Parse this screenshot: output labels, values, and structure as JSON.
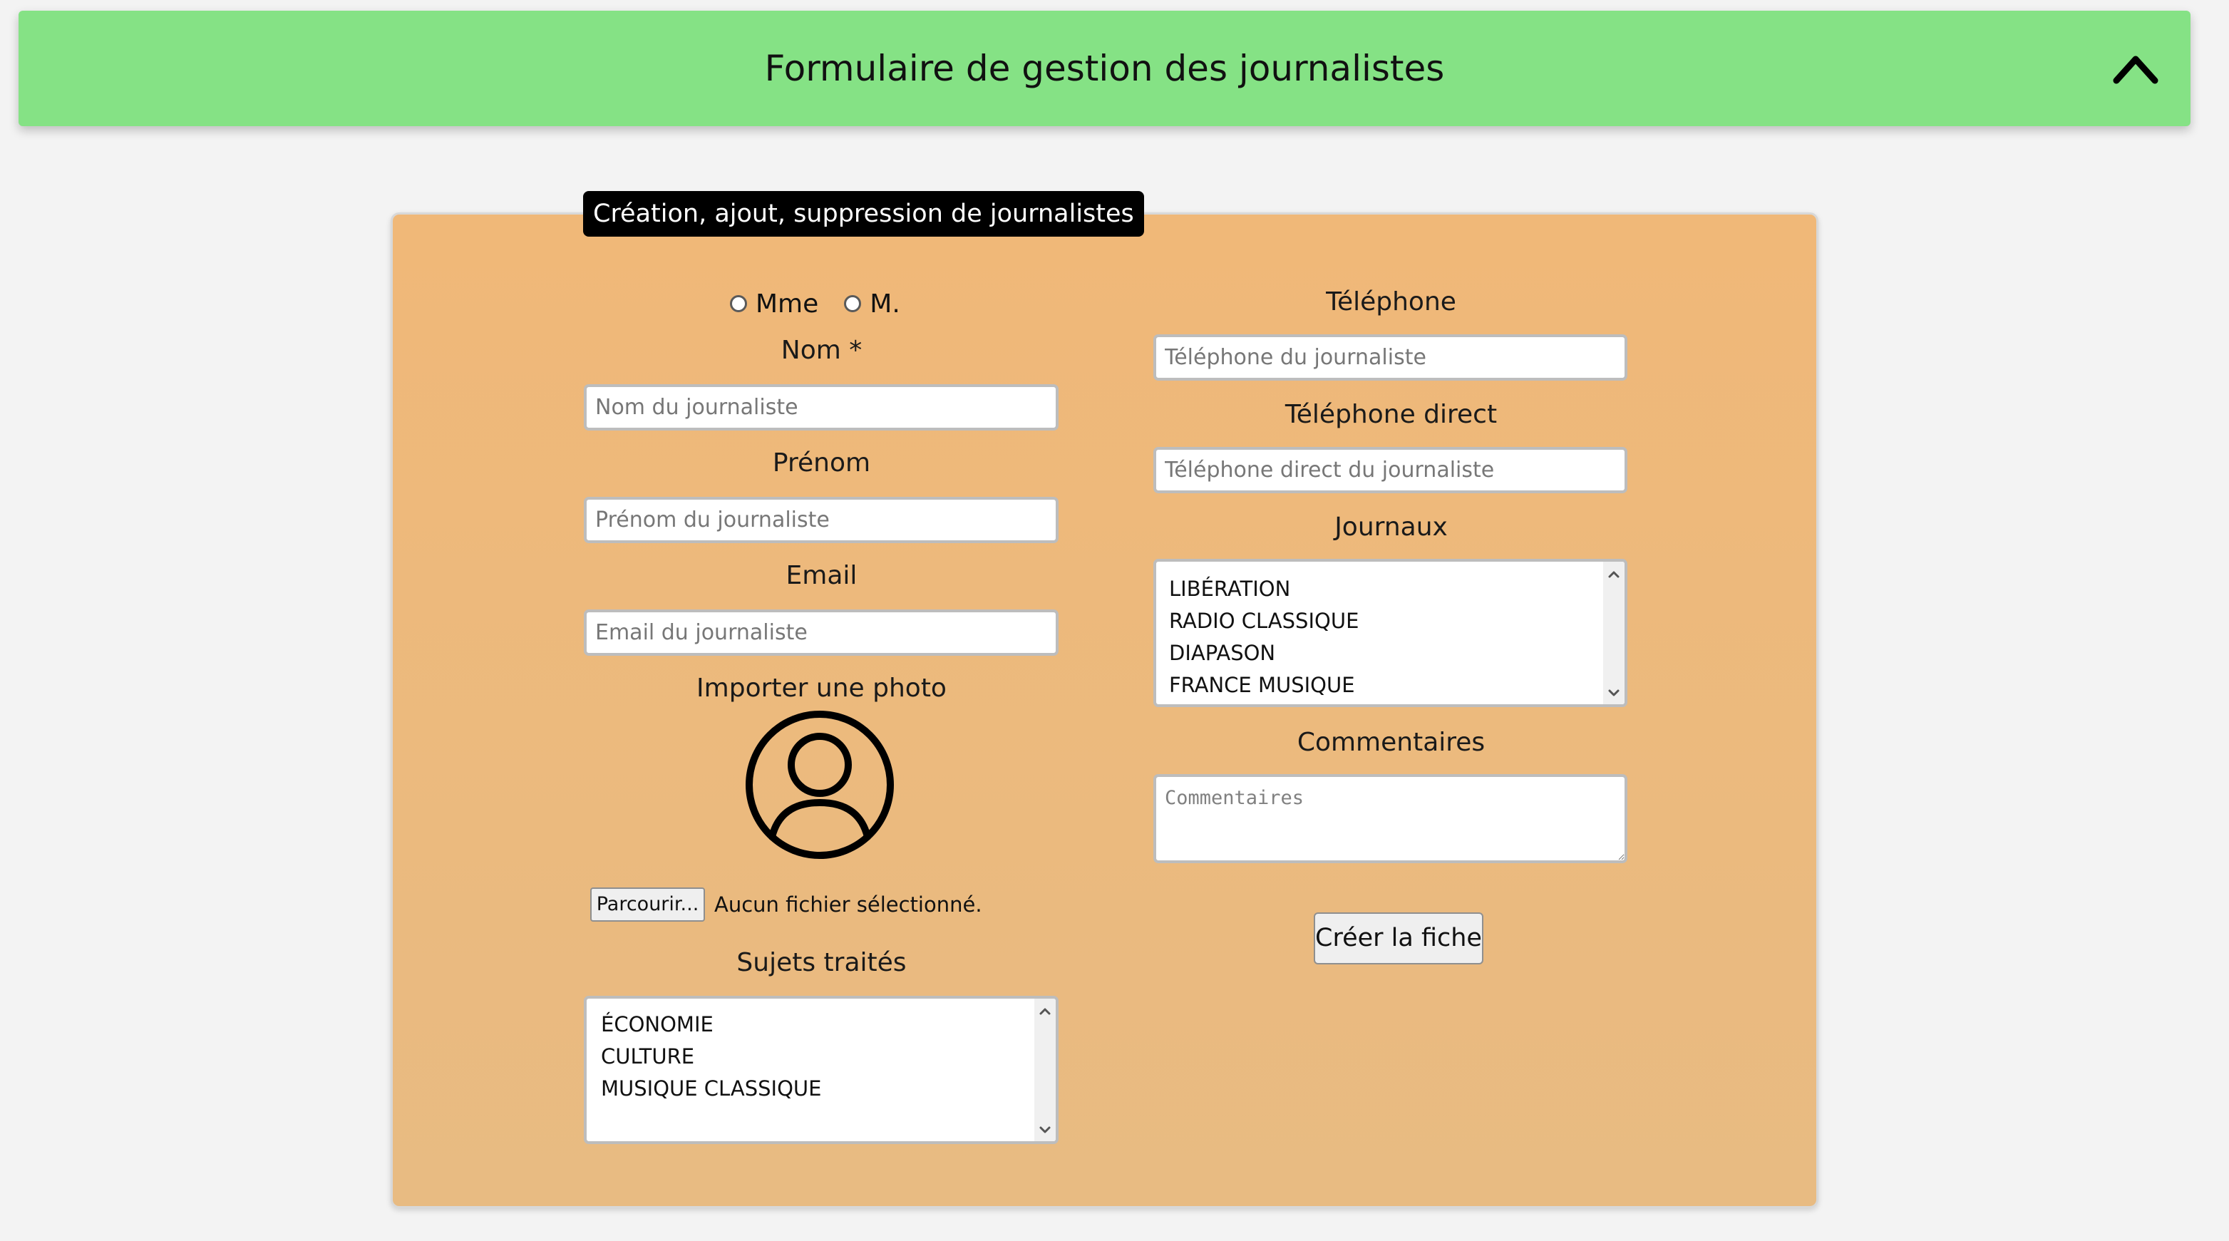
{
  "header": {
    "title": "Formulaire de gestion des journalistes",
    "collapse_icon": "chevron-up-icon"
  },
  "form": {
    "legend": "Création, ajout, suppression de journalistes",
    "civility": {
      "options": [
        "Mme",
        "M."
      ]
    },
    "nom": {
      "label": "Nom *",
      "placeholder": "Nom du journaliste",
      "value": ""
    },
    "prenom": {
      "label": "Prénom",
      "placeholder": "Prénom du journaliste",
      "value": ""
    },
    "email": {
      "label": "Email",
      "placeholder": "Email du journaliste",
      "value": ""
    },
    "photo": {
      "label": "Importer une photo",
      "icon": "user-circle-icon",
      "browse_label": "Parcourir...",
      "status": "Aucun fichier sélectionné."
    },
    "sujets": {
      "label": "Sujets traités",
      "options": [
        "ÉCONOMIE",
        "CULTURE",
        "MUSIQUE CLASSIQUE"
      ]
    },
    "telephone": {
      "label": "Téléphone",
      "placeholder": "Téléphone du journaliste",
      "value": ""
    },
    "telephone_direct": {
      "label": "Téléphone direct",
      "placeholder": "Téléphone direct du journaliste",
      "value": ""
    },
    "journaux": {
      "label": "Journaux",
      "options": [
        "LIBÉRATION",
        "RADIO CLASSIQUE",
        "DIAPASON",
        "FRANCE MUSIQUE"
      ]
    },
    "commentaires": {
      "label": "Commentaires",
      "placeholder": "Commentaires",
      "value": ""
    },
    "submit_label": "Créer la fiche"
  },
  "colors": {
    "header_bg": "#85e285",
    "panel_bg": "#f0b878",
    "legend_bg": "#000000"
  }
}
